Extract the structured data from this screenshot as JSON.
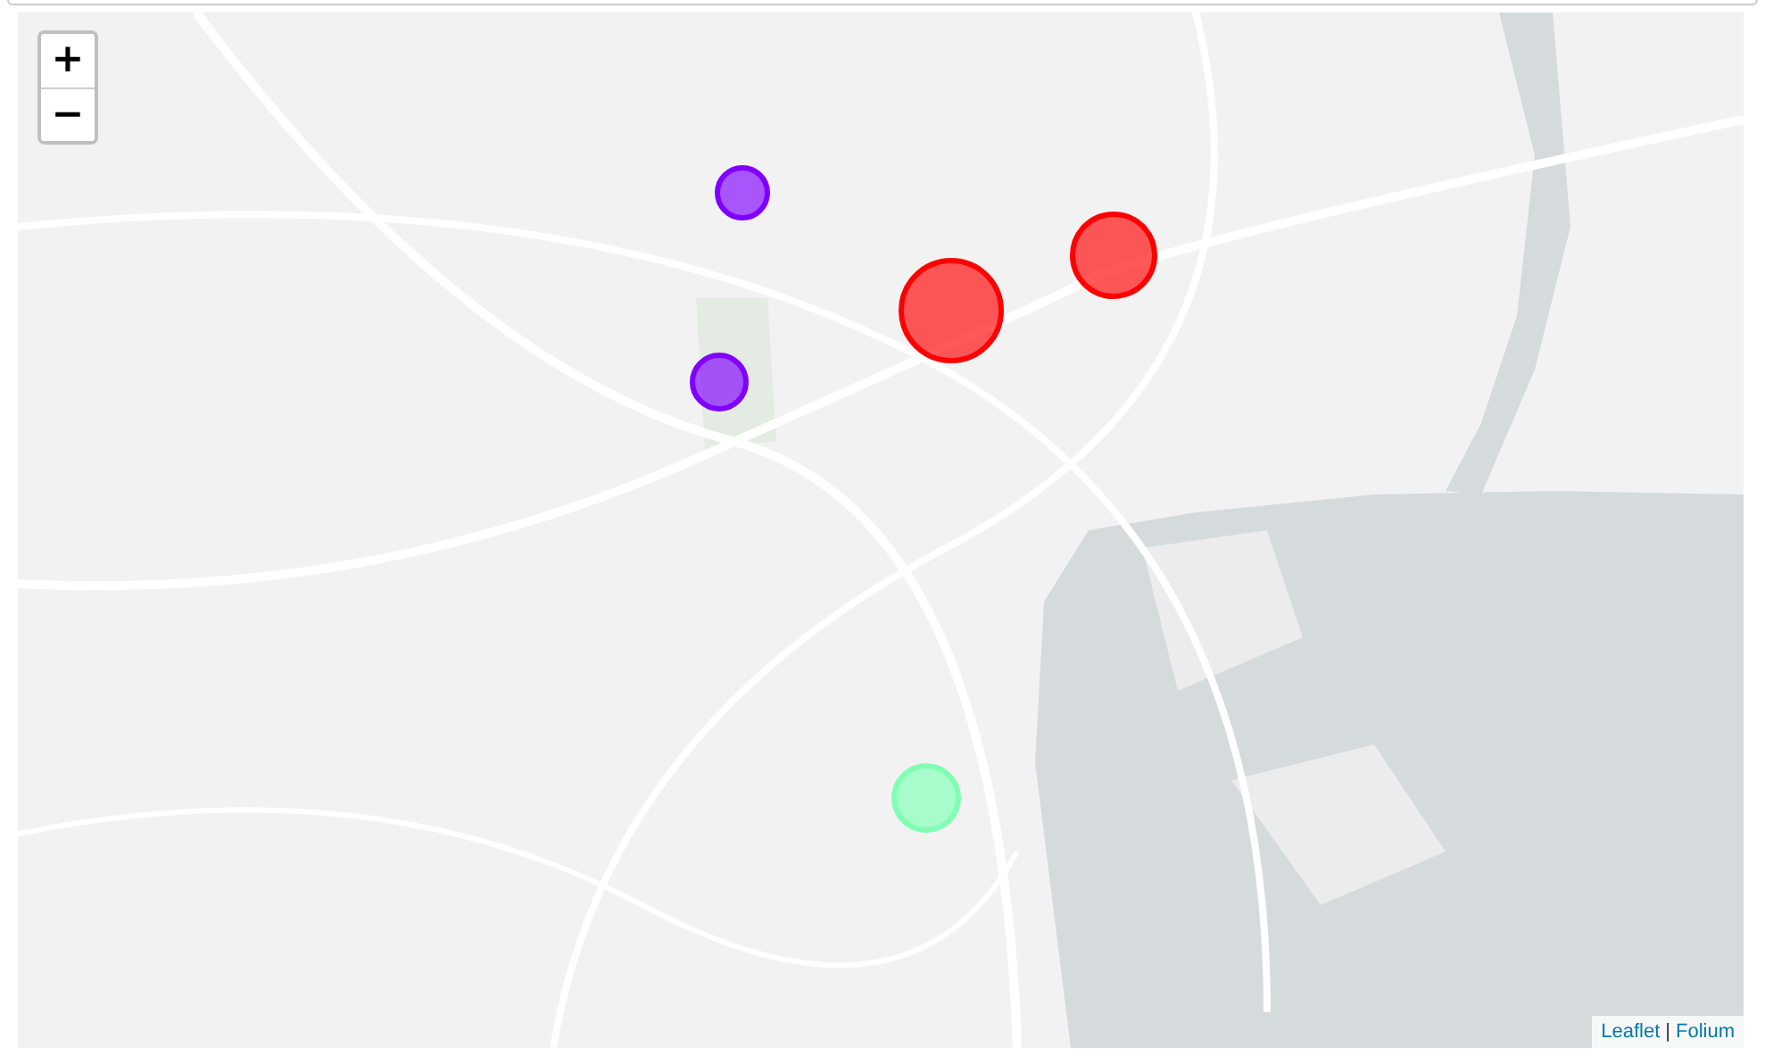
{
  "zoom_controls": [
    {
      "label": "+"
    },
    {
      "label": "−"
    }
  ],
  "markers": [
    {
      "color": "#ff0000"
    },
    {
      "color": "#ff0000"
    },
    {
      "color": "#8000ff"
    },
    {
      "color": "#8000ff"
    },
    {
      "color": "#80ffb4"
    }
  ],
  "attribution": {
    "links": [
      "Leaflet",
      "Folium"
    ],
    "separator": "|"
  }
}
